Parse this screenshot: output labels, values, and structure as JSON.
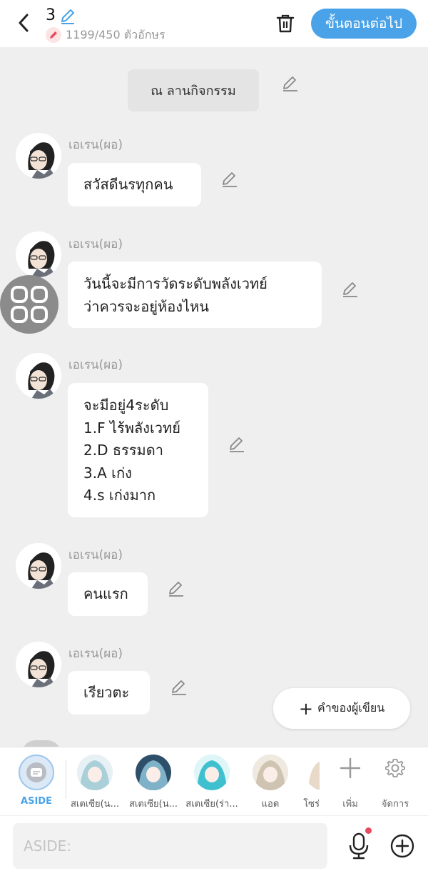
{
  "header": {
    "chapter_number": "3",
    "char_count": "1199/450 ตัวอักษร",
    "next_label": "ขั้นตอนต่อไป"
  },
  "scene": {
    "label": "ณ ลานกิจกรรม"
  },
  "messages": [
    {
      "speaker": "เอเรน(ผอ)",
      "lines": [
        "สวัสดีนรทุกคน"
      ]
    },
    {
      "speaker": "เอเรน(ผอ)",
      "lines": [
        "วันนี้จะมีการวัดระดับพลังเวทย์",
        "ว่าควรจะอยู่ห้องไหน"
      ]
    },
    {
      "speaker": "เอเรน(ผอ)",
      "lines": [
        "จะมีอยู่4ระดับ",
        "1.F ไร้พลังเวทย์",
        "2.D ธรรมดา",
        "3.A เก่ง",
        "4.s เก่งมาก"
      ]
    },
    {
      "speaker": "เอเรน(ผอ)",
      "lines": [
        "คนแรก"
      ]
    },
    {
      "speaker": "เอเรน(ผอ)",
      "lines": [
        "เรียวตะ"
      ]
    }
  ],
  "author_note": {
    "label": "คำของผู้เขียน"
  },
  "char_bar": {
    "aside": {
      "label": "ASIDE"
    },
    "characters": [
      {
        "label": "สเตเซีย(น...",
        "color": "#a9cfd8"
      },
      {
        "label": "สเตเซีย(น...",
        "color": "#7fb2c8"
      },
      {
        "label": "สเตเซีย(ร่า...",
        "color": "#3fc0cf"
      },
      {
        "label": "แอด",
        "color": "#cfc4b2"
      },
      {
        "label": "โซร่",
        "color": "#e8d9c8"
      }
    ],
    "add_label": "เพิ่ม",
    "manage_label": "จัดการ"
  },
  "input": {
    "placeholder": "ASIDE:"
  },
  "colors": {
    "accent": "#4aa3e8",
    "background": "#efefef",
    "notification_dot": "#e84a5f"
  }
}
